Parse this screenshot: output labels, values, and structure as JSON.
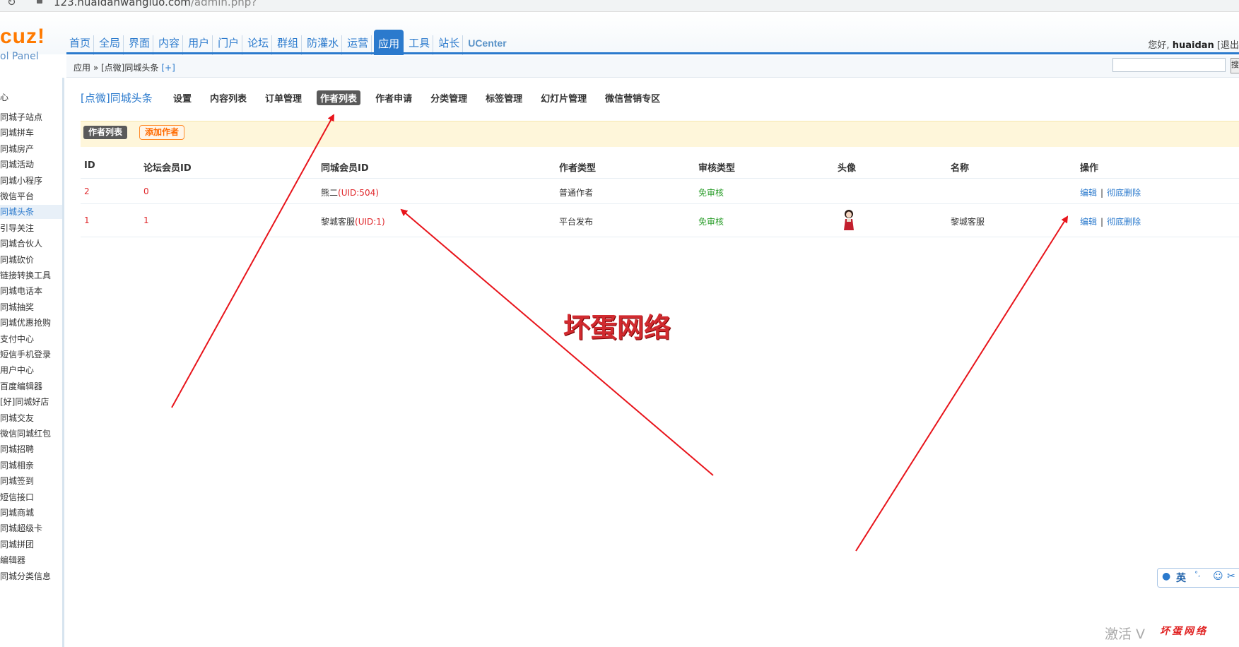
{
  "browser": {
    "address_domain": "123.huaidanwangluo.com",
    "address_path": "/admin.php?"
  },
  "header": {
    "logo_text": "cuz!",
    "logo_sub": "ol Panel",
    "nav": [
      "首页",
      "全局",
      "界面",
      "内容",
      "用户",
      "门户",
      "论坛",
      "群组",
      "防灌水",
      "运营",
      "应用",
      "工具",
      "站长",
      "UCenter"
    ],
    "active_nav": "应用",
    "greeting": "您好,",
    "username": "huaidan",
    "logout_partial": "[退出"
  },
  "breadcrumb": {
    "path": "应用 » [点微]同城头条",
    "add": "[+]",
    "search_button": "搜"
  },
  "sidebar": {
    "top_item": "心",
    "items": [
      "同城子站点",
      "同城拼车",
      "同城房产",
      "同城活动",
      "同城小程序",
      "微信平台",
      "同城头条",
      "引导关注",
      "同城合伙人",
      "同城砍价",
      "链接转换工具",
      "同城电话本",
      "同城抽奖",
      "同城优惠抢购",
      "支付中心",
      "短信手机登录",
      "用户中心",
      "百度编辑器",
      "[好]同城好店",
      "同城交友",
      "微信同城红包",
      "同城招聘",
      "同城相亲",
      "同城签到",
      "短信接口",
      "同城商城",
      "同城超级卡",
      "同城拼团",
      "编辑器",
      "同城分类信息"
    ],
    "active": "同城头条"
  },
  "main": {
    "app_title": "[点微]同城头条",
    "subnav": [
      "设置",
      "内容列表",
      "订单管理",
      "作者列表",
      "作者申请",
      "分类管理",
      "标签管理",
      "幻灯片管理",
      "微信营销专区"
    ],
    "active_subnav": "作者列表",
    "btn_author_list": "作者列表",
    "btn_add_author": "添加作者"
  },
  "table": {
    "columns": [
      "ID",
      "论坛会员ID",
      "同城会员ID",
      "作者类型",
      "审核类型",
      "头像",
      "名称",
      "操作"
    ],
    "rows": [
      {
        "id": "2",
        "forum_uid": "0",
        "city_member": "熊二",
        "city_uid": "(UID:504)",
        "type": "普通作者",
        "audit": "免审核",
        "name": "",
        "edit": "编辑",
        "delete": "彻底删除"
      },
      {
        "id": "1",
        "forum_uid": "1",
        "city_member": "黎城客服",
        "city_uid": "(UID:1)",
        "type": "平台发布",
        "audit": "免审核",
        "name": "黎城客服",
        "edit": "编辑",
        "delete": "彻底删除"
      }
    ],
    "action_separator": "|"
  },
  "overlay": {
    "watermark": "坏蛋网络",
    "ime_label": "英",
    "activate_text": "激活 V",
    "watermark_small": "坏蛋网络",
    "arrow_color": "#e8141b"
  }
}
